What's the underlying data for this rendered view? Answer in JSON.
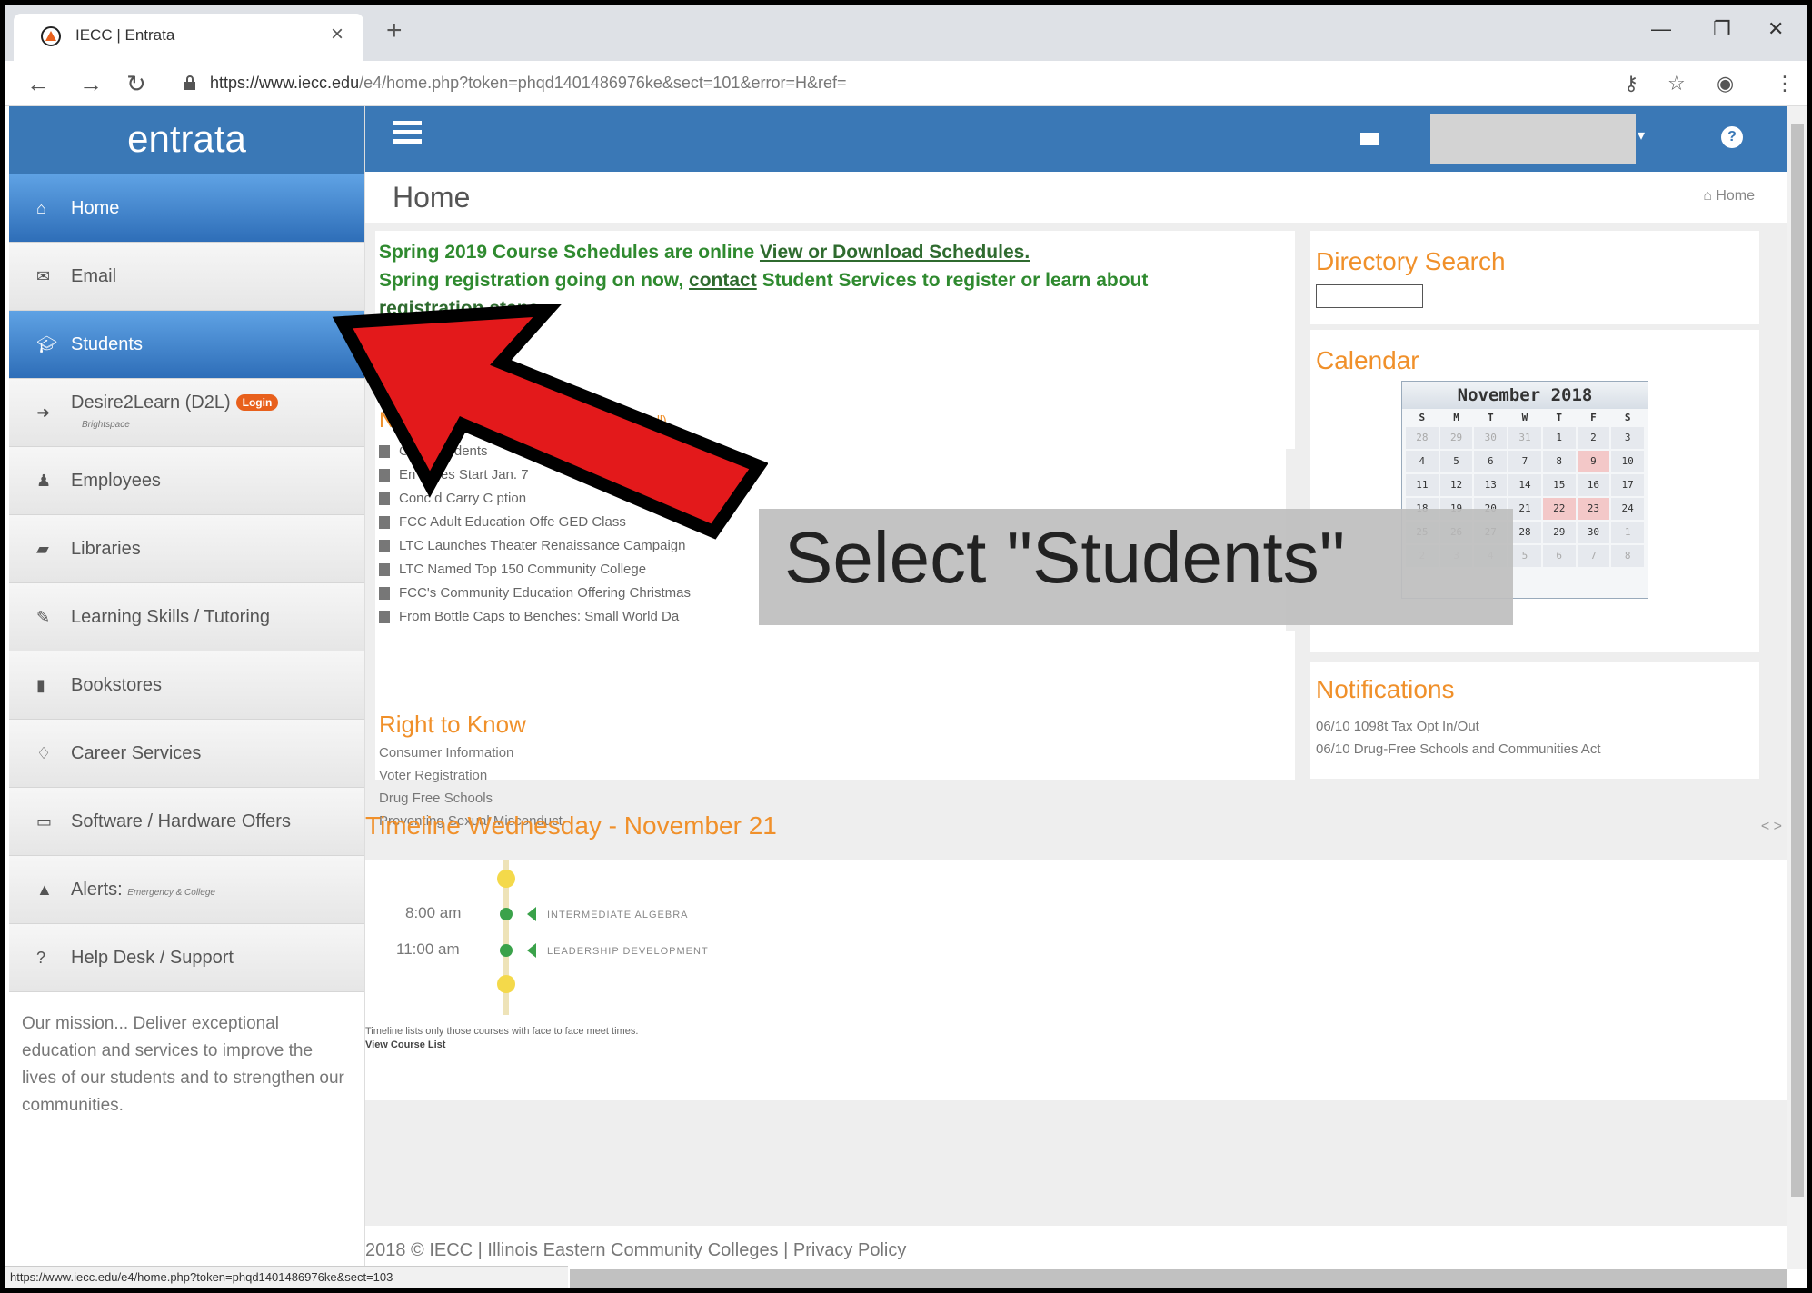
{
  "browser": {
    "tab_title": "IECC | Entrata",
    "url_host": "https://www.iecc.edu",
    "url_path": "/e4/home.php?token=phqd1401486976ke&sect=101&error=H&ref=",
    "status_url": "https://www.iecc.edu/e4/home.php?token=phqd1401486976ke&sect=103"
  },
  "sidebar": {
    "logo": "entrata",
    "items": [
      {
        "label": "Home",
        "icon": "home-icon"
      },
      {
        "label": "Email",
        "icon": "envelope-icon"
      },
      {
        "label": "Students",
        "icon": "graduation-cap-icon"
      },
      {
        "label": "Desire2Learn (D2L)",
        "badge": "Login",
        "sub": "Brightspace",
        "icon": "sign-in-icon"
      },
      {
        "label": "Employees",
        "icon": "user-icon"
      },
      {
        "label": "Libraries",
        "icon": "book-icon"
      },
      {
        "label": "Learning Skills / Tutoring",
        "icon": "edit-icon"
      },
      {
        "label": "Bookstores",
        "icon": "bookmark-icon"
      },
      {
        "label": "Career Services",
        "icon": "lightbulb-icon"
      },
      {
        "label": "Software / Hardware Offers",
        "icon": "laptop-icon"
      },
      {
        "label": "Alerts:",
        "sub": "Emergency & College",
        "icon": "warning-icon"
      },
      {
        "label": "Help Desk / Support",
        "icon": "question-icon"
      }
    ],
    "mission": "Our mission... Deliver exceptional education and services to improve the lives of our students and to strengthen our communities."
  },
  "page": {
    "title": "Home",
    "breadcrumb": "Home"
  },
  "announcement": {
    "line1": "Spring 2019 Course Schedules are online ",
    "line1_link": "View or Download Schedules.",
    "line2a": "Spring registration going on now, ",
    "line2_link": "contact",
    "line2b": " Student Services to register or learn about ",
    "line3_link": "registration steps",
    "line3_end": "."
  },
  "news": {
    "title_partial": "N",
    "see_all": "to see all)",
    "items": [
      "C                                                      ew Students",
      "En                                                     asses Start Jan. 7",
      "Conc      d Carry C                        ption",
      "FCC Adult Education Offe                  GED Class",
      "LTC Launches Theater Renaissance Campaign",
      "LTC Named Top 150 Community College",
      "FCC's Community Education Offering Christmas",
      "From Bottle Caps to Benches: Small World Da"
    ]
  },
  "right_to_know": {
    "title": "Right to Know",
    "items": [
      "Consumer Information",
      "Voter Registration",
      "Drug Free Schools",
      "Preventing Sexual Misconduct"
    ]
  },
  "directory": {
    "title": "Directory Search"
  },
  "calendar": {
    "title": "Calendar",
    "month": "November 2018",
    "dow": [
      "S",
      "M",
      "T",
      "W",
      "T",
      "F",
      "S"
    ],
    "cells": [
      "28",
      "29",
      "30",
      "31",
      "1",
      "2",
      "3",
      "4",
      "5",
      "6",
      "7",
      "8",
      "9",
      "10",
      "11",
      "12",
      "13",
      "14",
      "15",
      "16",
      "17",
      "18",
      "19",
      "20",
      "21",
      "22",
      "23",
      "24",
      "25",
      "26",
      "27",
      "28",
      "29",
      "30",
      "1",
      "2",
      "3",
      "4",
      "5",
      "6",
      "7",
      "8"
    ]
  },
  "notifications": {
    "title": "Notifications",
    "items": [
      "06/10 1098t Tax Opt In/Out",
      "06/10 Drug-Free Schools and Communities Act"
    ]
  },
  "timeline": {
    "title": "Timeline Wednesday - November 21",
    "nav": "< >",
    "entries": [
      {
        "time": "8:00 am",
        "course": "INTERMEDIATE ALGEBRA"
      },
      {
        "time": "11:00 am",
        "course": "LEADERSHIP DEVELOPMENT"
      }
    ],
    "note": "Timeline lists only those courses with face to face meet times.",
    "link": "View Course List"
  },
  "footer": {
    "text": "2018 © IECC | Illinois Eastern Community Colleges | Privacy Policy"
  },
  "annotation": {
    "text": "Select \"Students\""
  },
  "colors": {
    "brand_blue": "#3a78b6",
    "accent_orange": "#f0902a",
    "announce_green": "#2f8a2f",
    "arrow_red": "#e3191b"
  }
}
